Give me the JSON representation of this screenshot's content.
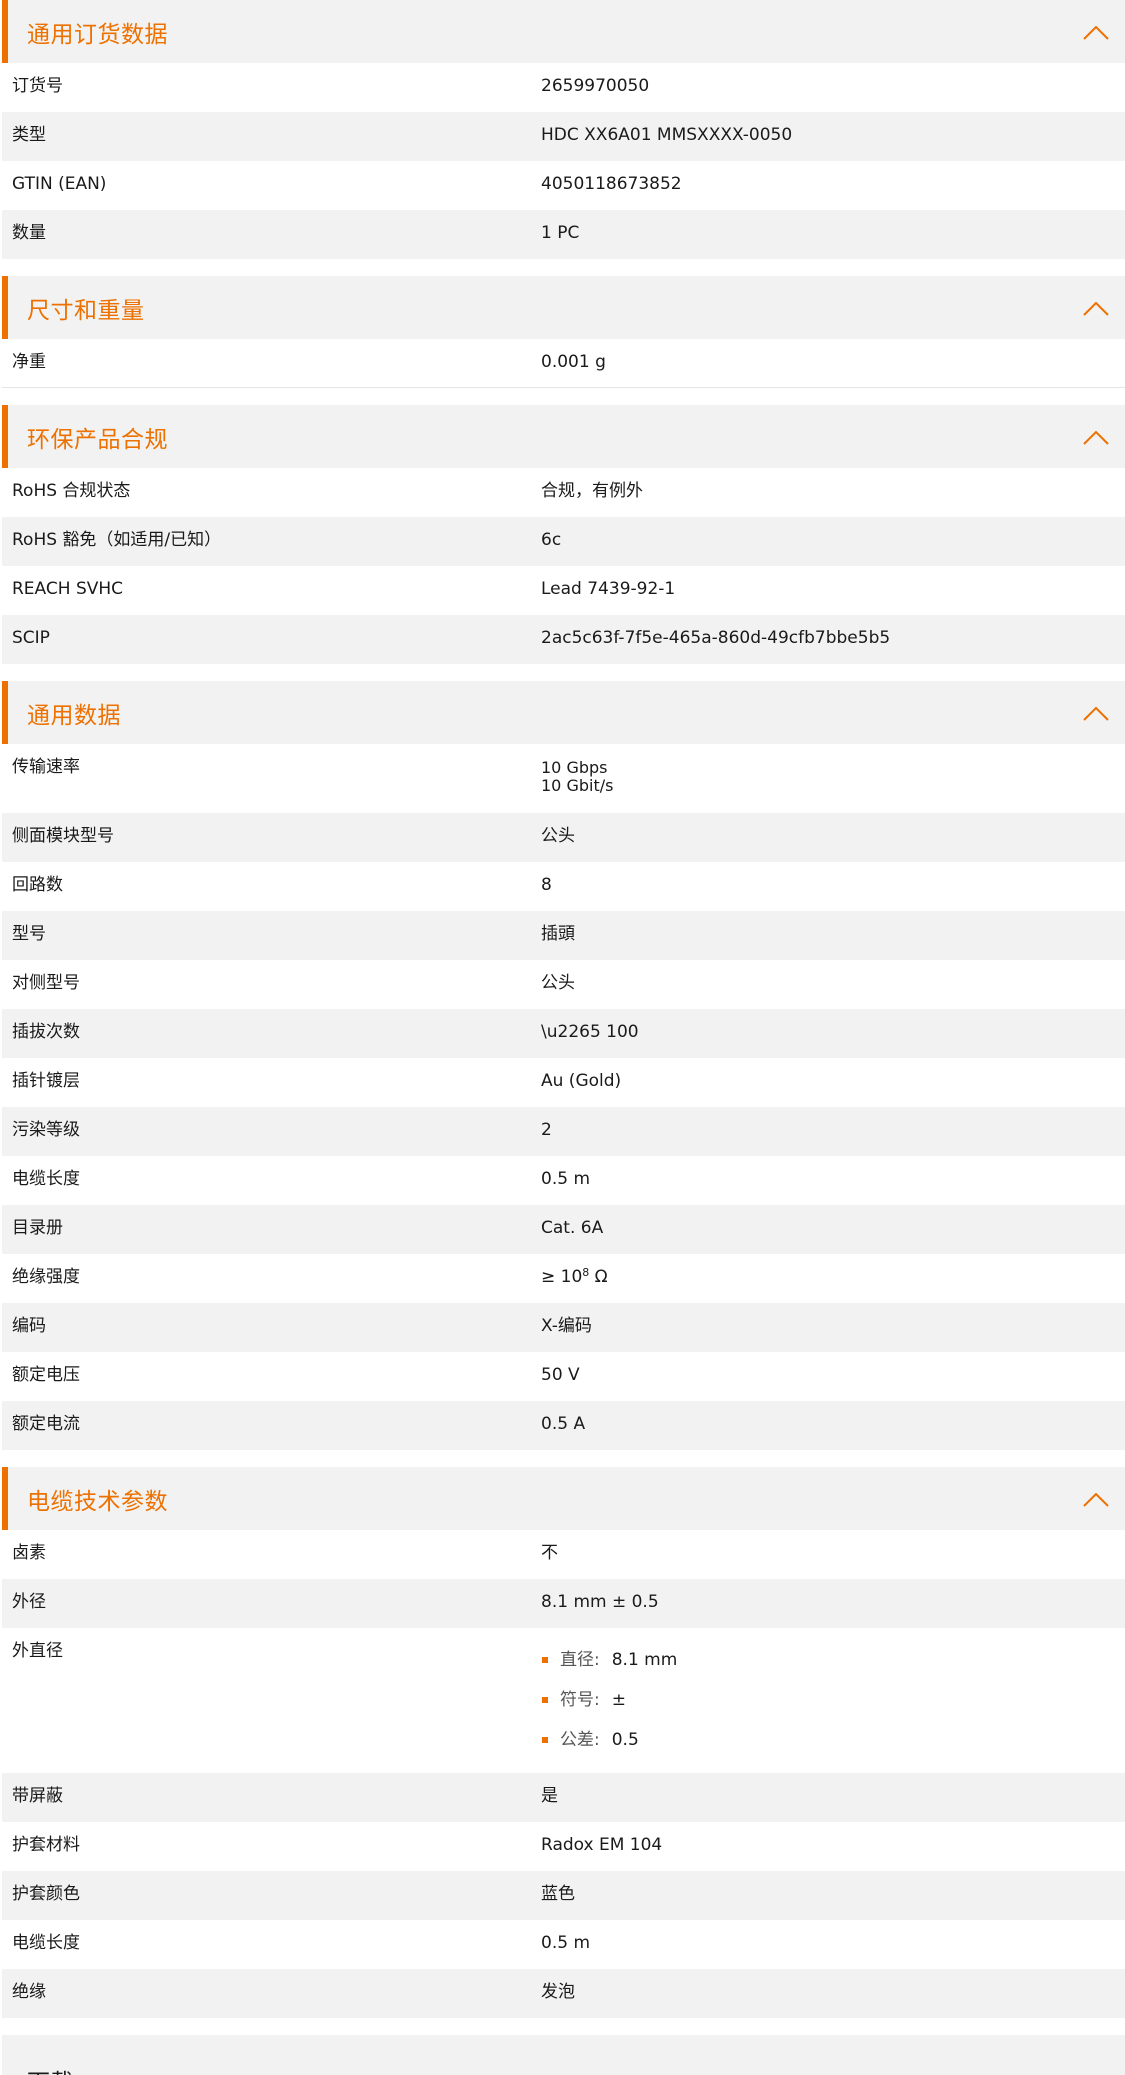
{
  "colors": {
    "accent": "#ed7100",
    "row_alt": "#f2f2f2",
    "row": "#ffffff"
  },
  "icons": {
    "collapse": "chevron-up-icon",
    "bullet": "square-bullet-icon"
  },
  "sections": [
    {
      "title": "通用订货数据",
      "rows": [
        {
          "label": "订货号",
          "value": "2659970050"
        },
        {
          "label": "类型",
          "value": "HDC XX6A01 MMSXXXX-0050"
        },
        {
          "label": "GTIN (EAN)",
          "value": "4050118673852"
        },
        {
          "label": "数量",
          "value": "1  PC"
        }
      ]
    },
    {
      "title": "尺寸和重量",
      "rows": [
        {
          "label": "净重",
          "value": "0.001  g"
        }
      ]
    },
    {
      "title": "环保产品合规",
      "rows": [
        {
          "label": "RoHS 合规状态",
          "value": "合规，有例外"
        },
        {
          "label": "RoHS 豁免（如适用/已知）",
          "value": "6c"
        },
        {
          "label": "REACH SVHC",
          "value": "Lead 7439-92-1"
        },
        {
          "label": "SCIP",
          "value": "2ac5c63f-7f5e-465a-860d-49cfb7bbe5b5"
        }
      ]
    },
    {
      "title": "通用数据",
      "rows": [
        {
          "label": "传输速率",
          "value_line1": "10 Gbps",
          "value_line2": "10 Gbit/s"
        },
        {
          "label": "侧面模块型号",
          "value": "公头"
        },
        {
          "label": "回路数",
          "value": "8"
        },
        {
          "label": "型号",
          "value": "插頭"
        },
        {
          "label": "对侧型号",
          "value": "公头"
        },
        {
          "label": "插拔次数",
          "value": "\\u2265 100"
        },
        {
          "label": "插针镀层",
          "value": "Au (Gold)"
        },
        {
          "label": "污染等级",
          "value": "2"
        },
        {
          "label": "电缆长度",
          "value": "0.5  m"
        },
        {
          "label": "目录册",
          "value": "Cat. 6A"
        },
        {
          "label": "绝缘强度",
          "value_prefix": "≥ 10",
          "value_sup": "8",
          "value_suffix": " Ω"
        },
        {
          "label": "编码",
          "value": "X-编码"
        },
        {
          "label": "额定电压",
          "value": "50  V"
        },
        {
          "label": "额定电流",
          "value": "0.5  A"
        }
      ]
    },
    {
      "title": "电缆技术参数",
      "rows": [
        {
          "label": "卤素",
          "value": "不"
        },
        {
          "label": "外径",
          "value": "8.1 mm ± 0.5"
        },
        {
          "label": "外直径",
          "list": [
            {
              "key": "直径:",
              "val": "8.1 mm"
            },
            {
              "key": "符号:",
              "val": "±"
            },
            {
              "key": "公差:",
              "val": "0.5"
            }
          ]
        },
        {
          "label": "带屏蔽",
          "value": "是"
        },
        {
          "label": "护套材料",
          "value": "Radox EM 104"
        },
        {
          "label": "护套颜色",
          "value": "蓝色"
        },
        {
          "label": "电缆长度",
          "value": "0.5  m"
        },
        {
          "label": "绝缘",
          "value": "发泡"
        }
      ]
    }
  ],
  "partial_section": {
    "title": "下载"
  }
}
